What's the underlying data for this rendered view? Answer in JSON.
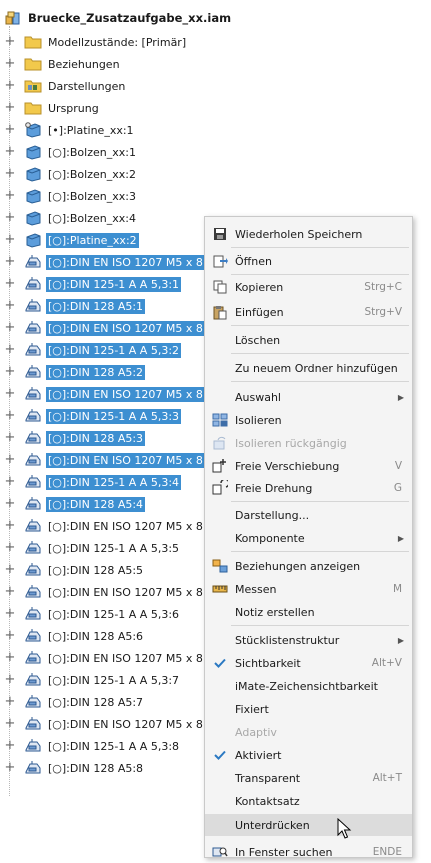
{
  "root": {
    "label": "Bruecke_Zusatzaufgabe_xx.iam"
  },
  "tree": [
    {
      "label": "Modellzustände: [Primär]",
      "icon": "folder-icon",
      "selected": false
    },
    {
      "label": "Beziehungen",
      "icon": "folder-icon",
      "selected": false
    },
    {
      "label": "Darstellungen",
      "icon": "representations-folder-icon",
      "selected": false
    },
    {
      "label": "Ursprung",
      "icon": "folder-icon",
      "selected": false
    },
    {
      "label": "[•]:Platine_xx:1",
      "icon": "grounded-part-icon",
      "selected": false
    },
    {
      "label": "[○]:Bolzen_xx:1",
      "icon": "part-icon",
      "selected": false
    },
    {
      "label": "[○]:Bolzen_xx:2",
      "icon": "part-icon",
      "selected": false
    },
    {
      "label": "[○]:Bolzen_xx:3",
      "icon": "part-icon",
      "selected": false
    },
    {
      "label": "[○]:Bolzen_xx:4",
      "icon": "part-icon",
      "selected": false
    },
    {
      "label": "[○]:Platine_xx:2",
      "icon": "part-icon",
      "selected": true
    },
    {
      "label": "[○]:DIN EN ISO 1207 M5 x 8:",
      "icon": "content-center-part-icon",
      "selected": true
    },
    {
      "label": "[○]:DIN 125-1 A A 5,3:1",
      "icon": "content-center-part-icon",
      "selected": true
    },
    {
      "label": "[○]:DIN 128 A5:1",
      "icon": "content-center-part-icon",
      "selected": true
    },
    {
      "label": "[○]:DIN EN ISO 1207 M5 x 8:",
      "icon": "content-center-part-icon",
      "selected": true
    },
    {
      "label": "[○]:DIN 125-1 A A 5,3:2",
      "icon": "content-center-part-icon",
      "selected": true
    },
    {
      "label": "[○]:DIN 128 A5:2",
      "icon": "content-center-part-icon",
      "selected": true
    },
    {
      "label": "[○]:DIN EN ISO 1207 M5 x 8:",
      "icon": "content-center-part-icon",
      "selected": true
    },
    {
      "label": "[○]:DIN 125-1 A A 5,3:3",
      "icon": "content-center-part-icon",
      "selected": true
    },
    {
      "label": "[○]:DIN 128 A5:3",
      "icon": "content-center-part-icon",
      "selected": true
    },
    {
      "label": "[○]:DIN EN ISO 1207 M5 x 8:",
      "icon": "content-center-part-icon",
      "selected": true
    },
    {
      "label": "[○]:DIN 125-1 A A 5,3:4",
      "icon": "content-center-part-icon",
      "selected": true
    },
    {
      "label": "[○]:DIN 128 A5:4",
      "icon": "content-center-part-icon",
      "selected": true
    },
    {
      "label": "[○]:DIN EN ISO 1207 M5 x 8:",
      "icon": "content-center-part-icon",
      "selected": false
    },
    {
      "label": "[○]:DIN 125-1 A A 5,3:5",
      "icon": "content-center-part-icon",
      "selected": false
    },
    {
      "label": "[○]:DIN 128 A5:5",
      "icon": "content-center-part-icon",
      "selected": false
    },
    {
      "label": "[○]:DIN EN ISO 1207 M5 x 8:",
      "icon": "content-center-part-icon",
      "selected": false
    },
    {
      "label": "[○]:DIN 125-1 A A 5,3:6",
      "icon": "content-center-part-icon",
      "selected": false
    },
    {
      "label": "[○]:DIN 128 A5:6",
      "icon": "content-center-part-icon",
      "selected": false
    },
    {
      "label": "[○]:DIN EN ISO 1207 M5 x 8:",
      "icon": "content-center-part-icon",
      "selected": false
    },
    {
      "label": "[○]:DIN 125-1 A A 5,3:7",
      "icon": "content-center-part-icon",
      "selected": false
    },
    {
      "label": "[○]:DIN 128 A5:7",
      "icon": "content-center-part-icon",
      "selected": false
    },
    {
      "label": "[○]:DIN EN ISO 1207 M5 x 8:",
      "icon": "content-center-part-icon",
      "selected": false
    },
    {
      "label": "[○]:DIN 125-1 A A 5,3:8",
      "icon": "content-center-part-icon",
      "selected": false
    },
    {
      "label": "[○]:DIN 128 A5:8",
      "icon": "content-center-part-icon",
      "selected": false
    }
  ],
  "menu": {
    "items": [
      {
        "label": "Wiederholen Speichern",
        "icon": "save-icon",
        "shortcut": "",
        "submenu": false,
        "disabled": false,
        "checked": false
      },
      {
        "label": "Öffnen",
        "icon": "open-icon",
        "shortcut": "",
        "submenu": false,
        "disabled": false,
        "checked": false
      },
      {
        "label": "Kopieren",
        "icon": "copy-icon",
        "shortcut": "Strg+C",
        "submenu": false,
        "disabled": false,
        "checked": false
      },
      {
        "label": "Einfügen",
        "icon": "paste-icon",
        "shortcut": "Strg+V",
        "submenu": false,
        "disabled": false,
        "checked": false
      },
      {
        "label": "Löschen",
        "icon": "",
        "shortcut": "",
        "submenu": false,
        "disabled": false,
        "checked": false
      },
      {
        "label": "Zu neuem Ordner hinzufügen",
        "icon": "",
        "shortcut": "",
        "submenu": false,
        "disabled": false,
        "checked": false
      },
      {
        "label": "Auswahl",
        "icon": "",
        "shortcut": "",
        "submenu": true,
        "disabled": false,
        "checked": false
      },
      {
        "label": "Isolieren",
        "icon": "isolate-icon",
        "shortcut": "",
        "submenu": false,
        "disabled": false,
        "checked": false
      },
      {
        "label": "Isolieren rückgängig",
        "icon": "undo-isolate-icon",
        "shortcut": "",
        "submenu": false,
        "disabled": true,
        "checked": false
      },
      {
        "label": "Freie Verschiebung",
        "icon": "free-move-icon",
        "shortcut": "V",
        "submenu": false,
        "disabled": false,
        "checked": false
      },
      {
        "label": "Freie Drehung",
        "icon": "free-rotate-icon",
        "shortcut": "G",
        "submenu": false,
        "disabled": false,
        "checked": false
      },
      {
        "label": "Darstellung...",
        "icon": "",
        "shortcut": "",
        "submenu": false,
        "disabled": false,
        "checked": false
      },
      {
        "label": "Komponente",
        "icon": "",
        "shortcut": "",
        "submenu": true,
        "disabled": false,
        "checked": false
      },
      {
        "label": "Beziehungen anzeigen",
        "icon": "show-constraints-icon",
        "shortcut": "",
        "submenu": false,
        "disabled": false,
        "checked": false
      },
      {
        "label": "Messen",
        "icon": "measure-icon",
        "shortcut": "M",
        "submenu": false,
        "disabled": false,
        "checked": false
      },
      {
        "label": "Notiz erstellen",
        "icon": "",
        "shortcut": "",
        "submenu": false,
        "disabled": false,
        "checked": false
      },
      {
        "label": "Stücklistenstruktur",
        "icon": "",
        "shortcut": "",
        "submenu": true,
        "disabled": false,
        "checked": false
      },
      {
        "label": "Sichtbarkeit",
        "icon": "",
        "shortcut": "Alt+V",
        "submenu": false,
        "disabled": false,
        "checked": true
      },
      {
        "label": "iMate-Zeichensichtbarkeit",
        "icon": "",
        "shortcut": "",
        "submenu": false,
        "disabled": false,
        "checked": false
      },
      {
        "label": "Fixiert",
        "icon": "",
        "shortcut": "",
        "submenu": false,
        "disabled": false,
        "checked": false
      },
      {
        "label": "Adaptiv",
        "icon": "",
        "shortcut": "",
        "submenu": false,
        "disabled": true,
        "checked": false
      },
      {
        "label": "Aktiviert",
        "icon": "",
        "shortcut": "",
        "submenu": false,
        "disabled": false,
        "checked": true
      },
      {
        "label": "Transparent",
        "icon": "",
        "shortcut": "Alt+T",
        "submenu": false,
        "disabled": false,
        "checked": false
      },
      {
        "label": "Kontaktsatz",
        "icon": "",
        "shortcut": "",
        "submenu": false,
        "disabled": false,
        "checked": false
      },
      {
        "label": "Unterdrücken",
        "icon": "",
        "shortcut": "",
        "submenu": false,
        "disabled": false,
        "checked": false,
        "highlighted": true
      },
      {
        "label": "In Fenster suchen",
        "icon": "find-in-window-icon",
        "shortcut": "ENDE",
        "submenu": false,
        "disabled": false,
        "checked": false
      }
    ]
  },
  "colors": {
    "selection": "#3d8fd1",
    "menu_bg": "#f4f4f4",
    "highlight": "#dcdcdc",
    "check": "#2b79c2"
  }
}
